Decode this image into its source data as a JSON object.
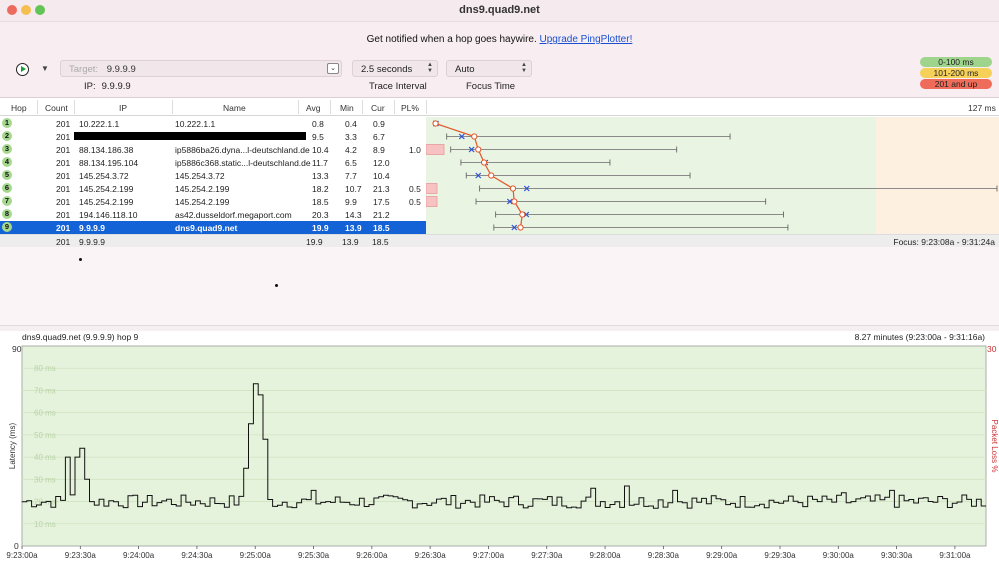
{
  "window": {
    "title": "dns9.quad9.net"
  },
  "banner": {
    "text": "Get notified when a hop goes haywire.",
    "link": "Upgrade PingPlotter!"
  },
  "toolbar": {
    "target_label": "Target:",
    "target_value": "9.9.9.9",
    "interval_value": "2.5 seconds",
    "focus_value": "Auto",
    "ip_label": "IP:",
    "ip_value": "9.9.9.9",
    "interval_label": "Trace Interval",
    "focus_label": "Focus Time",
    "legend": [
      "0-100 ms",
      "101-200 ms",
      "201 and up"
    ]
  },
  "table": {
    "headers": {
      "hop": "Hop",
      "count": "Count",
      "ip": "IP",
      "name": "Name",
      "avg": "Avg",
      "min": "Min",
      "cur": "Cur",
      "pl": "PL%",
      "scale": "127 ms"
    },
    "rows": [
      {
        "hop": "1",
        "count": "201",
        "ip": "10.222.1.1",
        "name": "10.222.1.1",
        "avg": "0.8",
        "min": "0.4",
        "cur": "0.9",
        "pl": ""
      },
      {
        "hop": "2",
        "count": "201",
        "ip": "",
        "name": "",
        "avg": "9.5",
        "min": "3.3",
        "cur": "6.7",
        "pl": ""
      },
      {
        "hop": "3",
        "count": "201",
        "ip": "88.134.186.38",
        "name": "ip5886ba26.dyna...l-deutschland.de",
        "avg": "10.4",
        "min": "4.2",
        "cur": "8.9",
        "pl": "1.0"
      },
      {
        "hop": "4",
        "count": "201",
        "ip": "88.134.195.104",
        "name": "ip5886c368.static...l-deutschland.de",
        "avg": "11.7",
        "min": "6.5",
        "cur": "12.0",
        "pl": ""
      },
      {
        "hop": "5",
        "count": "201",
        "ip": "145.254.3.72",
        "name": "145.254.3.72",
        "avg": "13.3",
        "min": "7.7",
        "cur": "10.4",
        "pl": ""
      },
      {
        "hop": "6",
        "count": "201",
        "ip": "145.254.2.199",
        "name": "145.254.2.199",
        "avg": "18.2",
        "min": "10.7",
        "cur": "21.3",
        "pl": "0.5"
      },
      {
        "hop": "7",
        "count": "201",
        "ip": "145.254.2.199",
        "name": "145.254.2.199",
        "avg": "18.5",
        "min": "9.9",
        "cur": "17.5",
        "pl": "0.5"
      },
      {
        "hop": "8",
        "count": "201",
        "ip": "194.146.118.10",
        "name": "as42.dusseldorf.megaport.com",
        "avg": "20.3",
        "min": "14.3",
        "cur": "21.2",
        "pl": ""
      },
      {
        "hop": "9",
        "count": "201",
        "ip": "9.9.9.9",
        "name": "dns9.quad9.net",
        "avg": "19.9",
        "min": "13.9",
        "cur": "18.5",
        "pl": ""
      }
    ],
    "trace_scale_max_ms": 127,
    "trace": [
      {
        "min": 0.4,
        "avg": 0.8,
        "cur": 0.9,
        "max": 0.8,
        "loss": 0
      },
      {
        "min": 3.3,
        "avg": 9.5,
        "cur": 6.7,
        "max": 67,
        "loss": 0
      },
      {
        "min": 4.2,
        "avg": 10.4,
        "cur": 8.9,
        "max": 55,
        "loss": 1.0
      },
      {
        "min": 6.5,
        "avg": 11.7,
        "cur": 12.0,
        "max": 40,
        "loss": 0
      },
      {
        "min": 7.7,
        "avg": 13.3,
        "cur": 10.4,
        "max": 58,
        "loss": 0
      },
      {
        "min": 10.7,
        "avg": 18.2,
        "cur": 21.3,
        "max": 127,
        "loss": 0.5
      },
      {
        "min": 9.9,
        "avg": 18.5,
        "cur": 17.5,
        "max": 75,
        "loss": 0.5
      },
      {
        "min": 14.3,
        "avg": 20.3,
        "cur": 21.2,
        "max": 79,
        "loss": 0
      },
      {
        "min": 13.9,
        "avg": 19.9,
        "cur": 18.5,
        "max": 80,
        "loss": 0
      }
    ],
    "summary": {
      "count": "201",
      "ip": "9.9.9.9",
      "avg": "19.9",
      "min": "13.9",
      "cur": "18.5",
      "focus": "Focus: 9:23:08a - 9:31:24a"
    }
  },
  "graph": {
    "title": "dns9.quad9.net (9.9.9.9) hop 9",
    "range": "8.27 minutes (9:23:00a - 9:31:16a)",
    "ylabel": "Latency (ms)",
    "y2label": "Packet Loss %",
    "y_max_label": "90",
    "y_zero_label": "0",
    "y2_max_label": "30",
    "gridlines": [
      "80 ms",
      "70 ms",
      "60 ms",
      "50 ms",
      "40 ms",
      "30 ms",
      "20 ms",
      "10 ms"
    ],
    "xticks": [
      "9:23:00a",
      "9:23:30a",
      "9:24:00a",
      "9:24:30a",
      "9:25:00a",
      "9:25:30a",
      "9:26:00a",
      "9:26:30a",
      "9:27:00a",
      "9:27:30a",
      "9:28:00a",
      "9:28:30a",
      "9:29:00a",
      "9:29:30a",
      "9:30:00a",
      "9:30:30a",
      "9:31:00a"
    ]
  },
  "colors": {
    "selected_row": "#1463d6",
    "trace_line": "#e2572b",
    "latency_bg": "#e6f3dc"
  }
}
